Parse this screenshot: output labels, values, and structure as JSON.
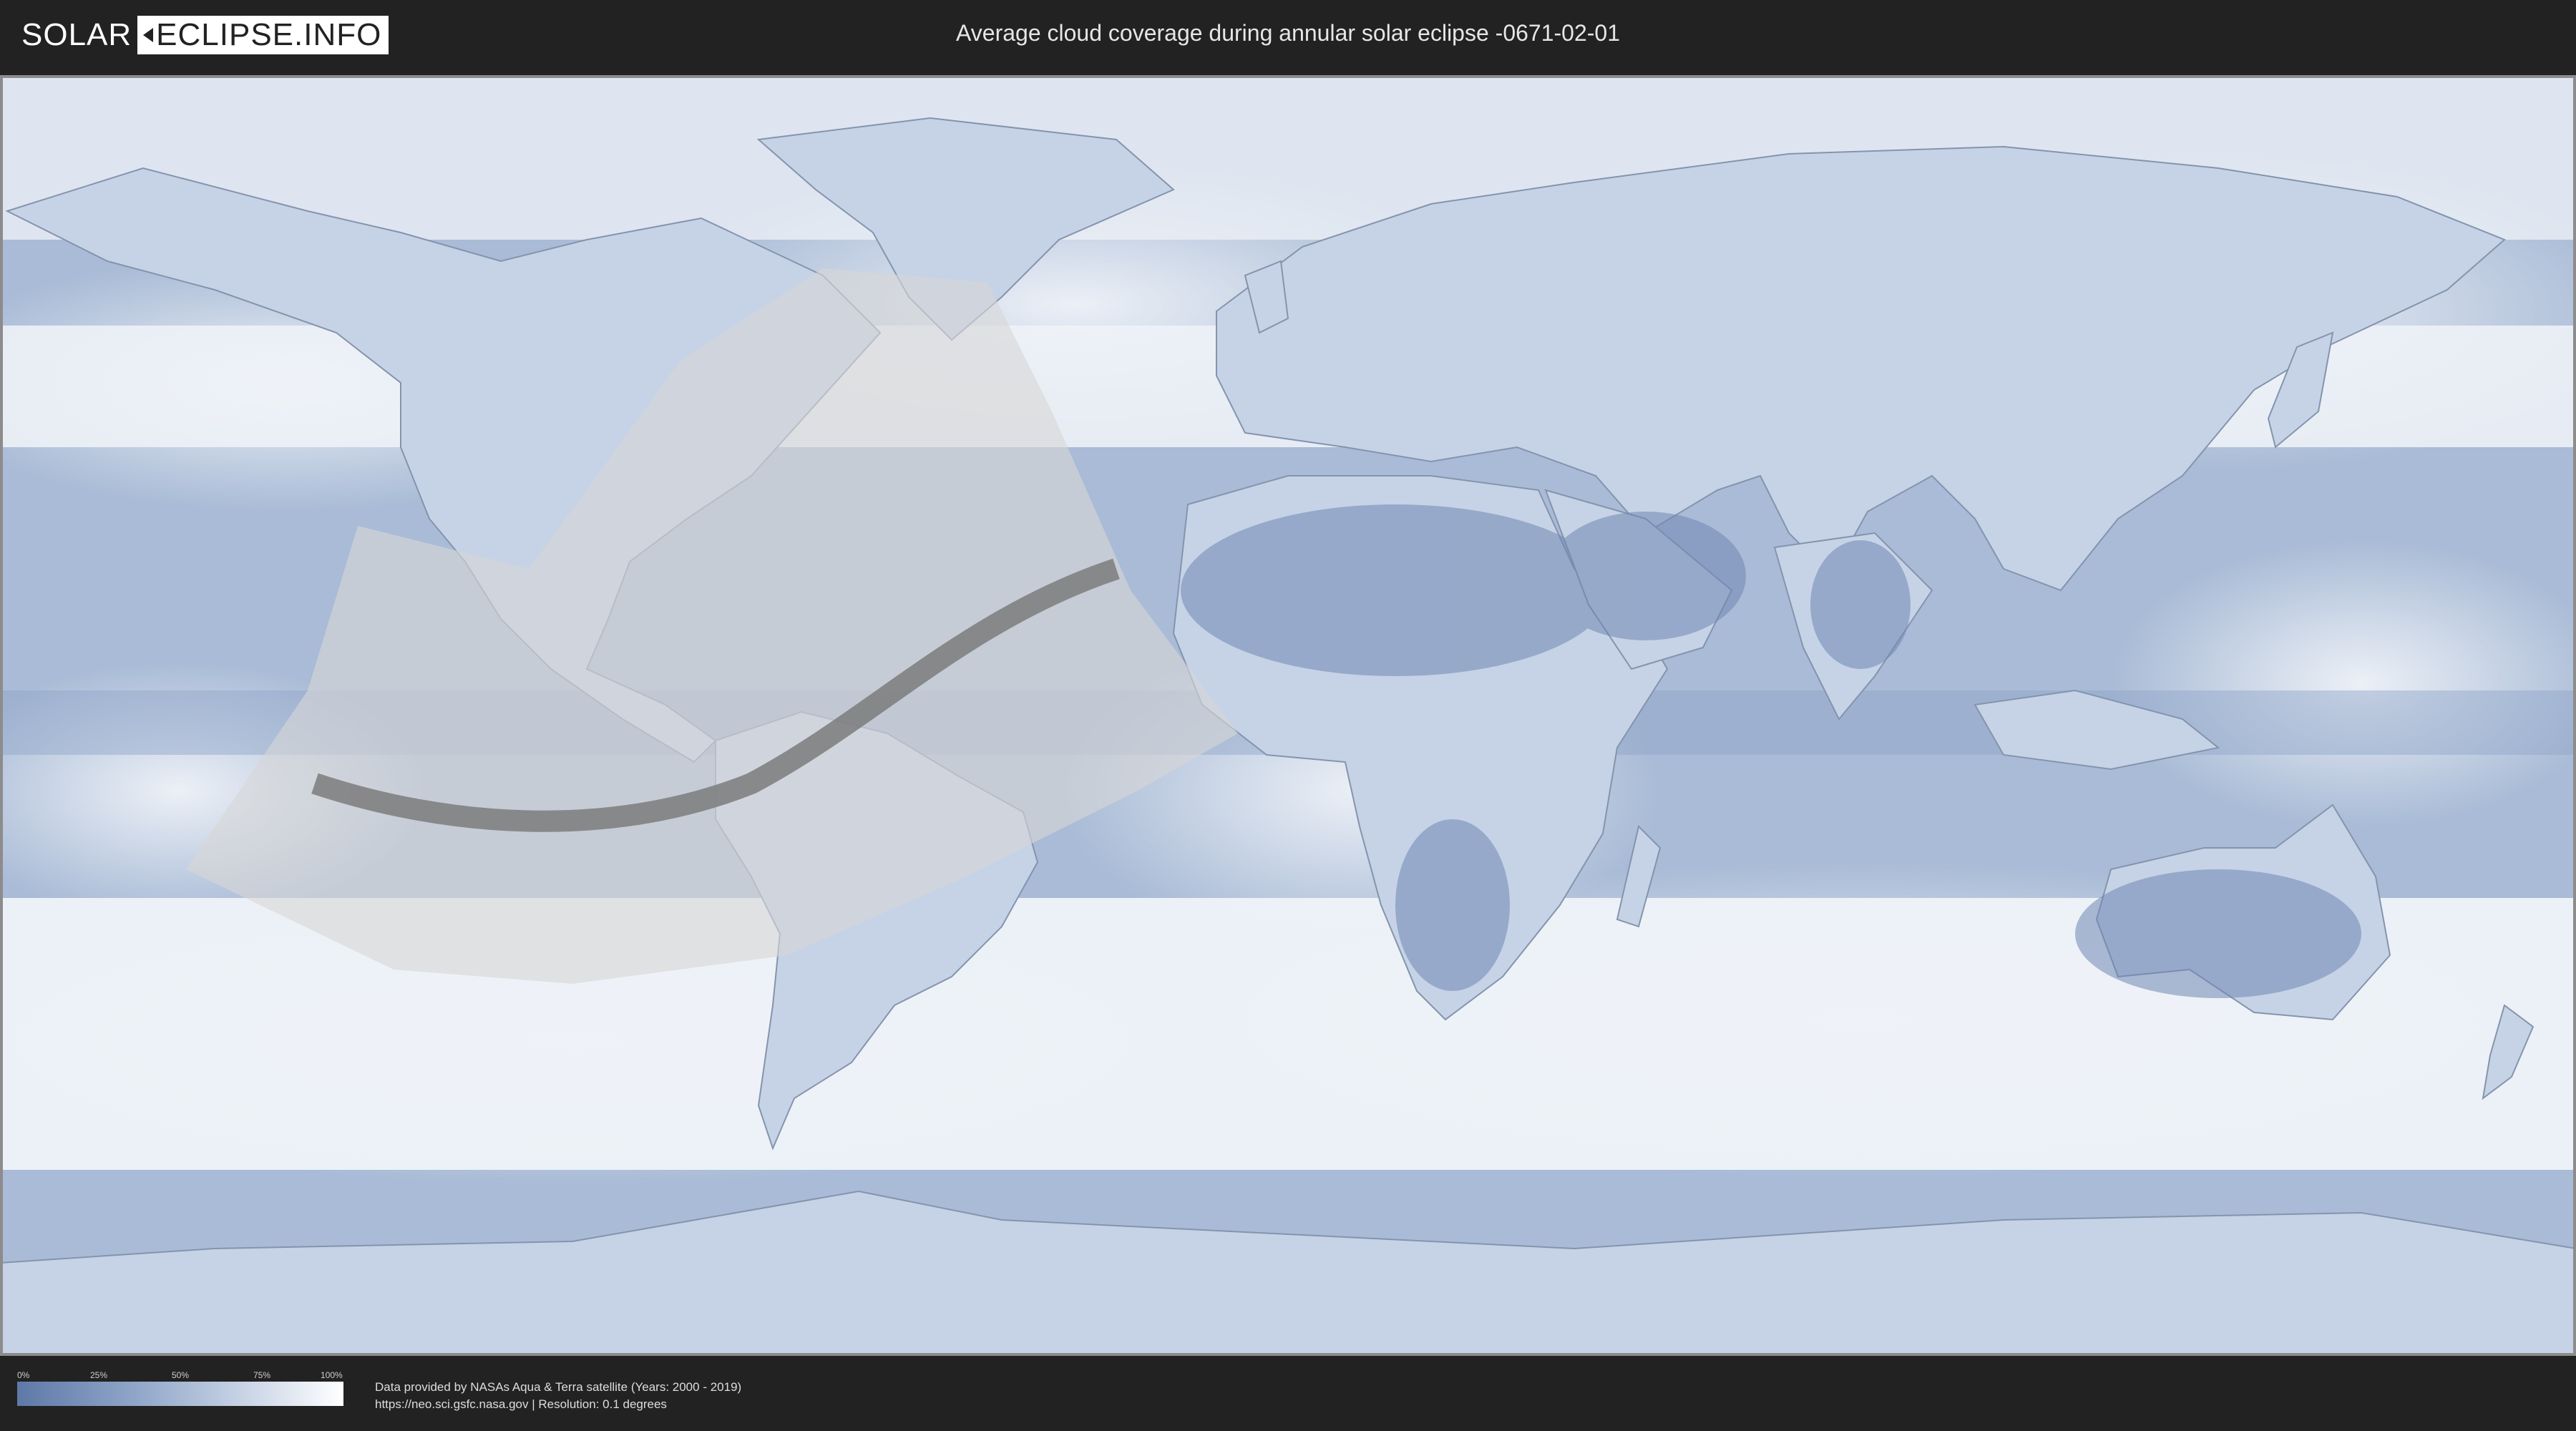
{
  "header": {
    "logo_left": "SOLAR",
    "logo_right": "ECLIPSE.INFO",
    "title": "Average cloud coverage during annular solar eclipse -0671-02-01"
  },
  "legend": {
    "ticks": [
      "0%",
      "25%",
      "50%",
      "75%",
      "100%"
    ],
    "colors": [
      "#5e79a8",
      "#8ea4c8",
      "#c9d4e6",
      "#ffffff"
    ]
  },
  "credits": {
    "line1": "Data provided by NASAs Aqua & Terra satellite (Years: 2000 - 2019)",
    "line2": "https://neo.sci.gsfc.nasa.gov | Resolution: 0.1 degrees"
  },
  "map": {
    "ocean_color": "#6f8bb8",
    "cloud_color": "#f2f5fa",
    "land_border_color": "#8494ad",
    "penumbra_color": "#d6d6d6",
    "central_path_color": "#7b7b7b"
  }
}
